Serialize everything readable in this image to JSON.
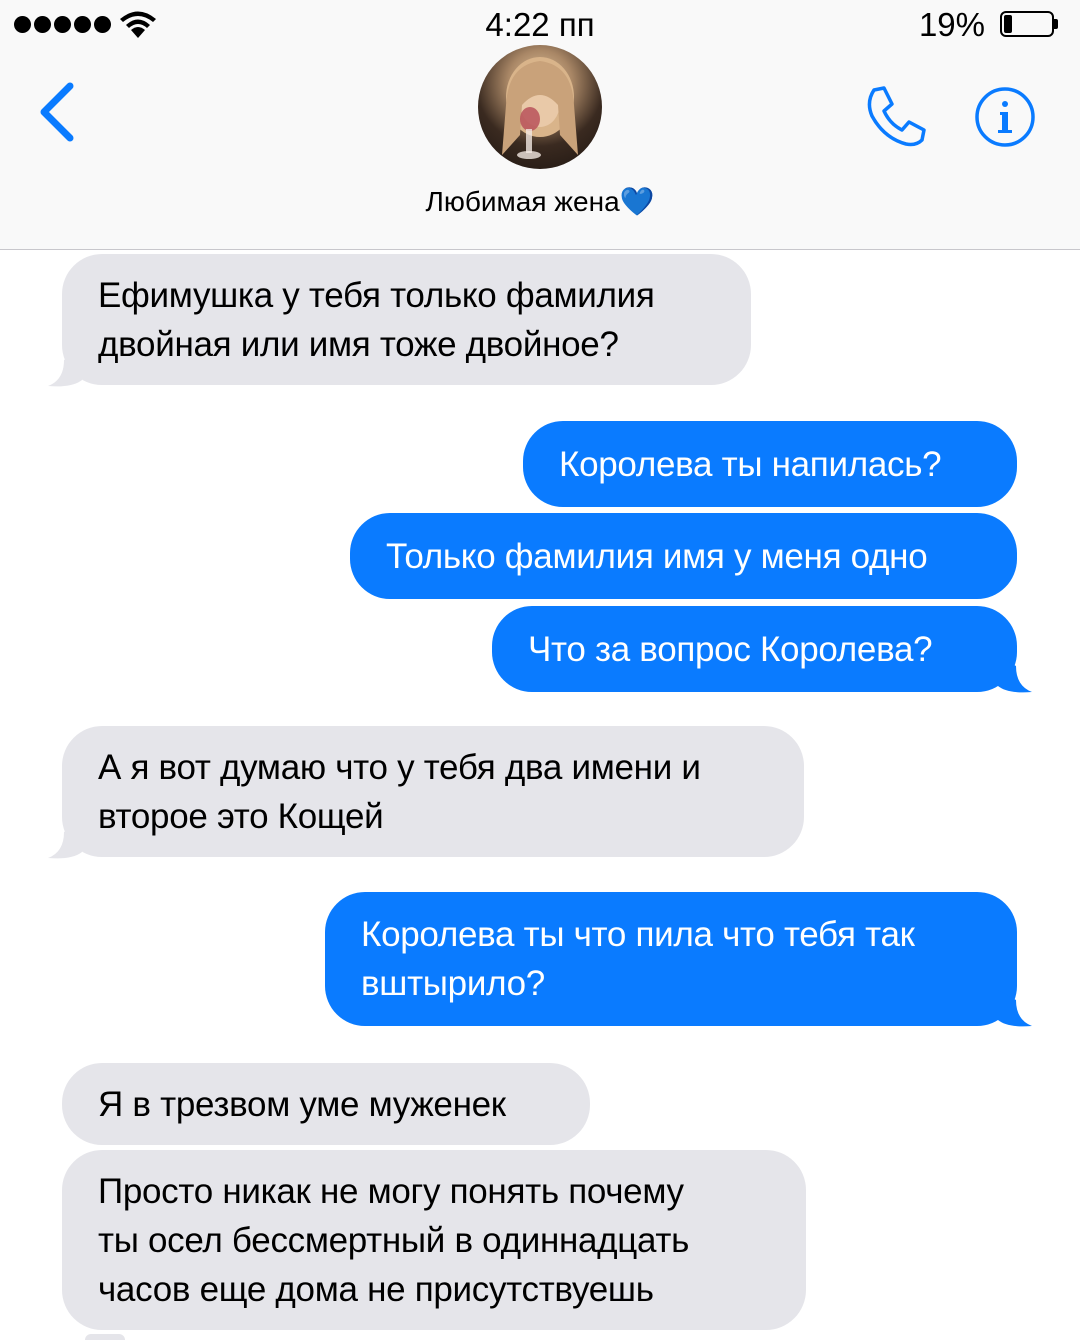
{
  "status_bar": {
    "time": "4:22 пп",
    "battery_percent": "19%",
    "signal_bars": 5,
    "battery_level": 0.19
  },
  "header": {
    "contact_name": "Любимая жена💙",
    "back_icon": "chevron-left-icon",
    "call_icon": "phone-icon",
    "info_icon": "info-icon"
  },
  "colors": {
    "accent": "#0a7bff",
    "incoming_bubble": "#e5e5ea",
    "outgoing_bubble": "#0a7bff"
  },
  "messages": [
    {
      "direction": "incoming",
      "text": "Ефимушка у тебя только фамилия\nдвойная или имя тоже двойное?"
    },
    {
      "direction": "outgoing",
      "text": "Королева ты напилась?"
    },
    {
      "direction": "outgoing",
      "text": "Только фамилия имя у меня одно"
    },
    {
      "direction": "outgoing",
      "text": "Что за вопрос Королева?"
    },
    {
      "direction": "incoming",
      "text": "А я вот думаю что у тебя два имени и\nвторое это Кощей"
    },
    {
      "direction": "outgoing",
      "text": "Королева ты что пила что тебя так\nвштырило?"
    },
    {
      "direction": "incoming",
      "text": "Я в трезвом уме муженек"
    },
    {
      "direction": "incoming",
      "text": "Просто никак не могу понять почему\nты осел бессмертный в одиннадцать\nчасов еще дома не присутствуешь"
    }
  ]
}
